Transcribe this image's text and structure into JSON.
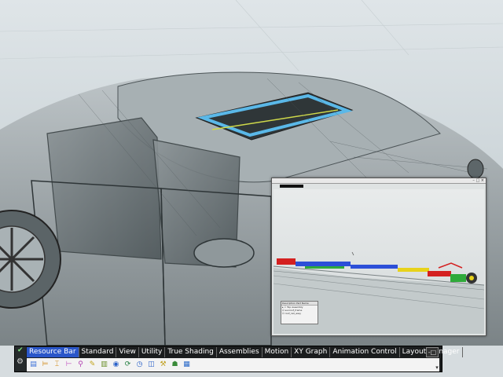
{
  "toolbar": {
    "tabs": [
      {
        "label": "Resource Bar",
        "active": true
      },
      {
        "label": "Standard"
      },
      {
        "label": "View"
      },
      {
        "label": "Utility"
      },
      {
        "label": "True Shading"
      },
      {
        "label": "Assemblies"
      },
      {
        "label": "Motion"
      },
      {
        "label": "XY Graph"
      },
      {
        "label": "Animation Control"
      },
      {
        "label": "Layout Manager"
      }
    ],
    "close_label": "-□",
    "icons": [
      {
        "name": "table-icon",
        "glyph": "▤",
        "color": "#3a6fd8"
      },
      {
        "name": "assembly-navigator-icon",
        "glyph": "⊨",
        "color": "#d08a18"
      },
      {
        "name": "part-navigator-icon",
        "glyph": "⌶",
        "color": "#d08a18"
      },
      {
        "name": "constraint-navigator-icon",
        "glyph": "⊢",
        "color": "#c14fbf"
      },
      {
        "name": "motion-navigator-icon",
        "glyph": "⚲",
        "color": "#b03fb0"
      },
      {
        "name": "reuse-library-icon",
        "glyph": "✎",
        "color": "#c1a21a"
      },
      {
        "name": "hd3d-tools-icon",
        "glyph": "▥",
        "color": "#6a8f2a"
      },
      {
        "name": "web-browser-icon",
        "glyph": "◉",
        "color": "#2b62c9"
      },
      {
        "name": "history-icon",
        "glyph": "⟳",
        "color": "#1c7a3a"
      },
      {
        "name": "clock-icon",
        "glyph": "◷",
        "color": "#2b62c9"
      },
      {
        "name": "system-materials-icon",
        "glyph": "◫",
        "color": "#2b62c9"
      },
      {
        "name": "process-studio-icon",
        "glyph": "⚒",
        "color": "#c0a020"
      },
      {
        "name": "roles-icon",
        "glyph": "☗",
        "color": "#3a8a3a"
      },
      {
        "name": "visualization-icon",
        "glyph": "▦",
        "color": "#2a6ac9"
      }
    ],
    "dropdown_glyph": "▾"
  },
  "subwindow": {
    "controls": "– □ ×",
    "panel_header": "Description Part Name",
    "panel_rows": [
      "▸ ☐ Top Assembly",
      "  ☑ sunroof_frame",
      "  ☑ roof_rail_assy"
    ]
  },
  "colors": {
    "accent_tab": "#2a56c9",
    "toolbar_bg": "#1b1d1e",
    "sunroof_highlight": "#5ab8e8",
    "part_red": "#d42020",
    "part_blue": "#2c4fd8",
    "part_yellow": "#e8d21a",
    "part_green": "#2faa3a"
  }
}
